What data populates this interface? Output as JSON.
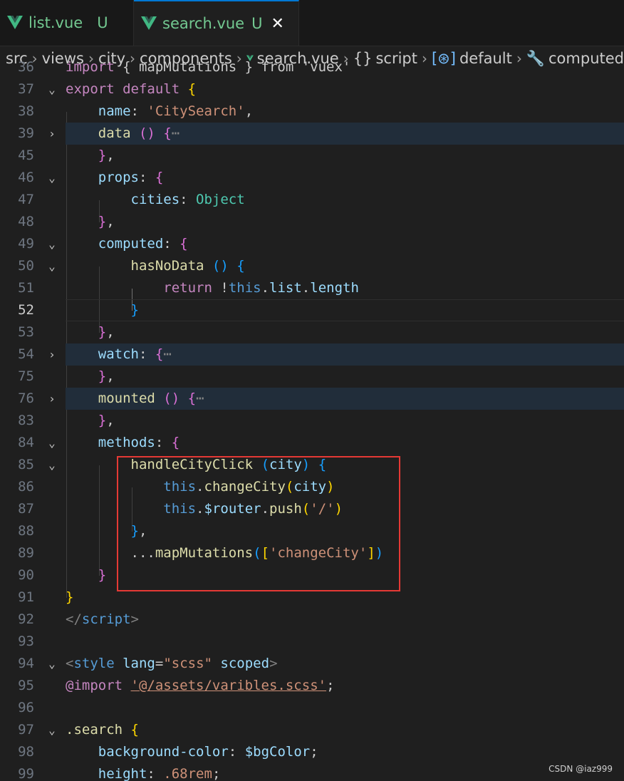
{
  "tabs": [
    {
      "label": "list.vue",
      "status": "U"
    },
    {
      "label": "search.vue",
      "status": "U",
      "close": "✕"
    }
  ],
  "breadcrumb": {
    "parts": [
      "src",
      "views",
      "city",
      "components"
    ],
    "file": "search.vue",
    "script": "script",
    "default": "default",
    "computed": "computed"
  },
  "editor": {
    "lines": [
      {
        "n": "36"
      },
      {
        "n": "37"
      },
      {
        "n": "38"
      },
      {
        "n": "39"
      },
      {
        "n": "45"
      },
      {
        "n": "46"
      },
      {
        "n": "47"
      },
      {
        "n": "48"
      },
      {
        "n": "49"
      },
      {
        "n": "50"
      },
      {
        "n": "51"
      },
      {
        "n": "52"
      },
      {
        "n": "53"
      },
      {
        "n": "54"
      },
      {
        "n": "75"
      },
      {
        "n": "76"
      },
      {
        "n": "83"
      },
      {
        "n": "84"
      },
      {
        "n": "85"
      },
      {
        "n": "86"
      },
      {
        "n": "87"
      },
      {
        "n": "88"
      },
      {
        "n": "89"
      },
      {
        "n": "90"
      },
      {
        "n": "91"
      },
      {
        "n": "92"
      },
      {
        "n": "93"
      },
      {
        "n": "94"
      },
      {
        "n": "95"
      },
      {
        "n": "96"
      },
      {
        "n": "97"
      },
      {
        "n": "98"
      },
      {
        "n": "99"
      }
    ],
    "tokens": {
      "import_kw": "import",
      "import_rest": " { mapMutations } from 'vuex'",
      "export": "export",
      "default": "default",
      "name_key": "name",
      "name_val": "'CitySearch'",
      "data": "data",
      "props": "props",
      "cities": "cities",
      "object": "Object",
      "computed": "computed",
      "hasNoData": "hasNoData",
      "return": "return",
      "this": "this",
      "list": "list",
      "length": "length",
      "watch": "watch",
      "mounted": "mounted",
      "methods": "methods",
      "handleCityClick": "handleCityClick",
      "city": "city",
      "changeCity": "changeCity",
      "router": "$router",
      "push": "push",
      "slash": "'/'",
      "mapMutations": "mapMutations",
      "changeCityStr": "'changeCity'",
      "script": "script",
      "style": "style",
      "lang": "lang",
      "scss": "\"scss\"",
      "scoped": "scoped",
      "import_at": "@import",
      "import_path": "'@/assets/varibles.scss'",
      "search_sel": ".search",
      "bg_prop": "background-color",
      "bg_val": "$bgColor",
      "height_prop": "height",
      "height_val": ".68rem"
    }
  },
  "watermark": "CSDN @iaz999"
}
